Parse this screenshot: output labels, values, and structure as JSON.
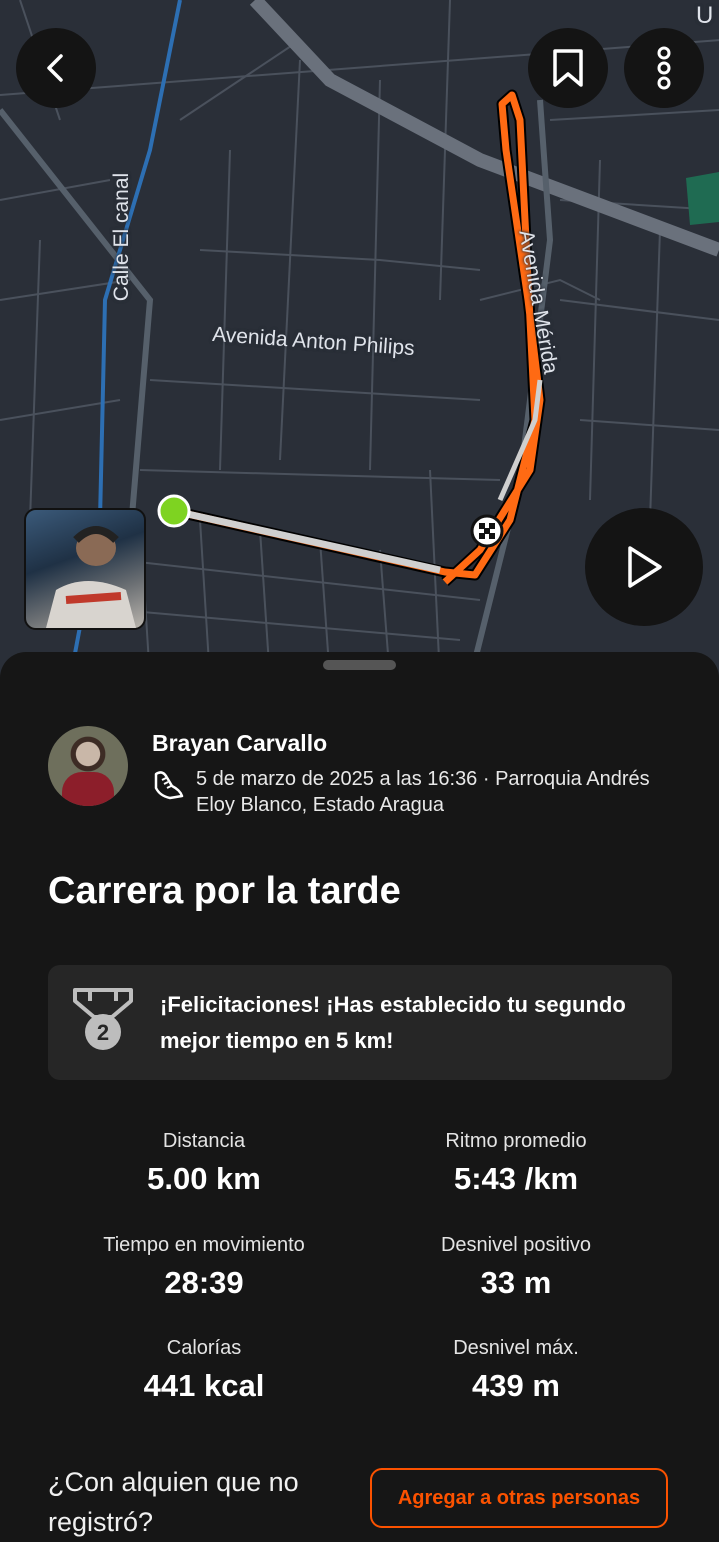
{
  "map": {
    "streets": [
      "Calle El canal",
      "Avenida Anton Philips",
      "Avenida Mérida"
    ],
    "corner_letter": "U"
  },
  "header": {
    "back_icon": "chevron-left-icon",
    "bookmark_icon": "bookmark-icon",
    "more_icon": "more-vertical-icon"
  },
  "activity": {
    "athlete": "Brayan Carvallo",
    "meta": "5 de marzo de 2025 a las 16:36 · Parroquia Andrés Eloy Blanco, Estado Aragua",
    "type_icon": "running-shoe-icon",
    "title": "Carrera por la tarde"
  },
  "achievement": {
    "icon": "medal-2-icon",
    "rank": "2",
    "text": "¡Felicitaciones! ¡Has establecido tu segundo mejor tiempo en 5 km!"
  },
  "stats": [
    {
      "label": "Distancia",
      "value": "5.00 km"
    },
    {
      "label": "Ritmo promedio",
      "value": "5:43 /km"
    },
    {
      "label": "Tiempo en movimiento",
      "value": "28:39"
    },
    {
      "label": "Desnivel positivo",
      "value": "33 m"
    },
    {
      "label": "Calorías",
      "value": "441 kcal"
    },
    {
      "label": "Desnivel máx.",
      "value": "439 m"
    }
  ],
  "footer": {
    "question": "¿Con alquien que no registró?",
    "add_button": "Agregar a otras personas"
  },
  "colors": {
    "accent": "#fc5200",
    "route": "#ff6a13",
    "start_marker": "#7ed321",
    "background": "#161616"
  }
}
